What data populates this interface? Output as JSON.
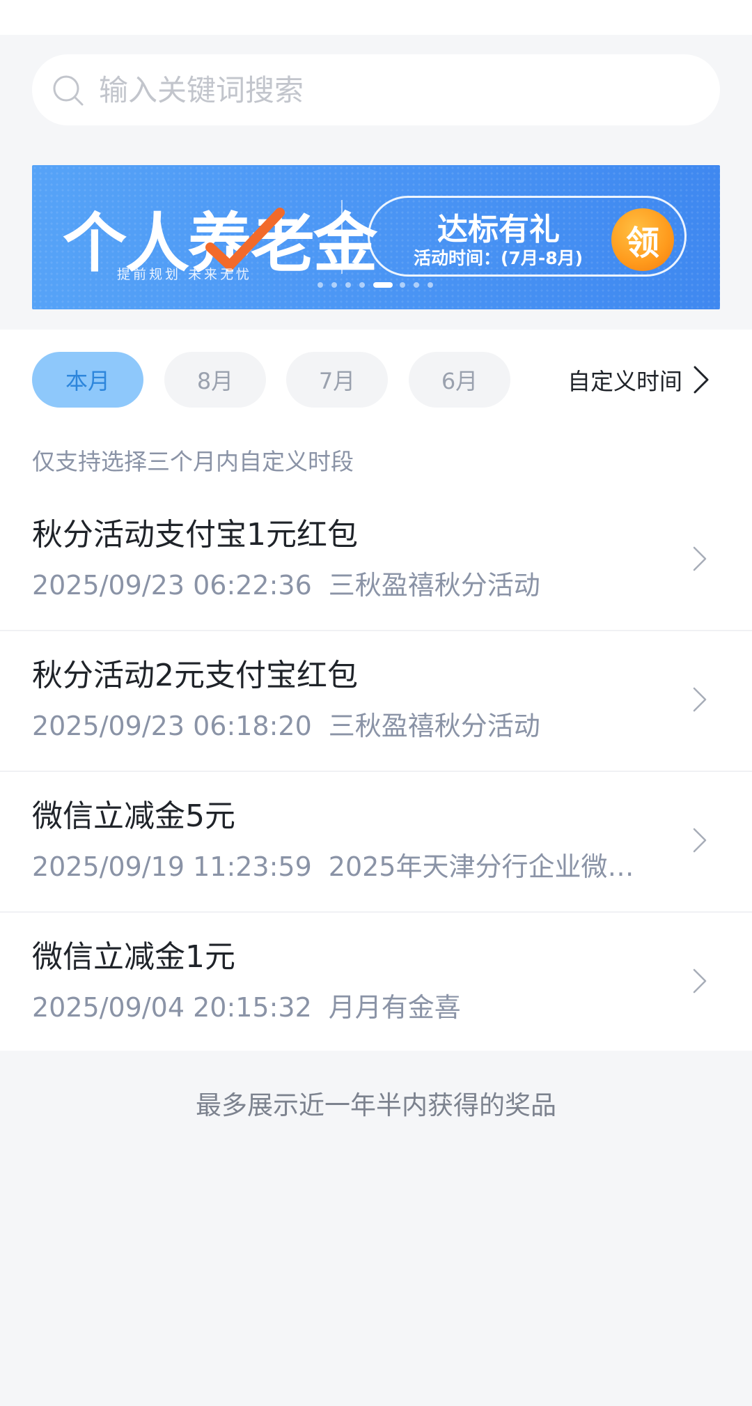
{
  "search": {
    "placeholder": "输入关键词搜索"
  },
  "banner": {
    "title": "个人养老金",
    "subtitle": "提前规划  未来无忧",
    "cta": "达标有礼",
    "time": "活动时间：(7月-8月)",
    "badge": "领",
    "accent": "#4d98f5",
    "badge_color": "#ff9a1c",
    "check_color": "#f26a2a"
  },
  "filters": {
    "chips": [
      "本月",
      "8月",
      "7月",
      "6月"
    ],
    "selected": "本月",
    "custom_label": "自定义时间",
    "hint": "仅支持选择三个月内自定义时段"
  },
  "items": [
    {
      "title": "秋分活动支付宝1元红包",
      "datetime": "2025/09/23 06:22:36",
      "activity": "三秋盈禧秋分活动"
    },
    {
      "title": "秋分活动2元支付宝红包",
      "datetime": "2025/09/23 06:18:20",
      "activity": "三秋盈禧秋分活动"
    },
    {
      "title": "微信立减金5元",
      "datetime": "2025/09/19 11:23:59",
      "activity": "2025年天津分行企业微信..."
    },
    {
      "title": "微信立减金1元",
      "datetime": "2025/09/04 20:15:32",
      "activity": "月月有金喜"
    }
  ],
  "footer": {
    "note": "最多展示近一年半内获得的奖品"
  },
  "icons": {
    "search": "search-icon",
    "chevron": "chevron-right-icon"
  },
  "colors": {
    "active_chip_bg": "#8ec8fb",
    "active_chip_text": "#2d86dc",
    "meta_text": "#8a93a6"
  }
}
